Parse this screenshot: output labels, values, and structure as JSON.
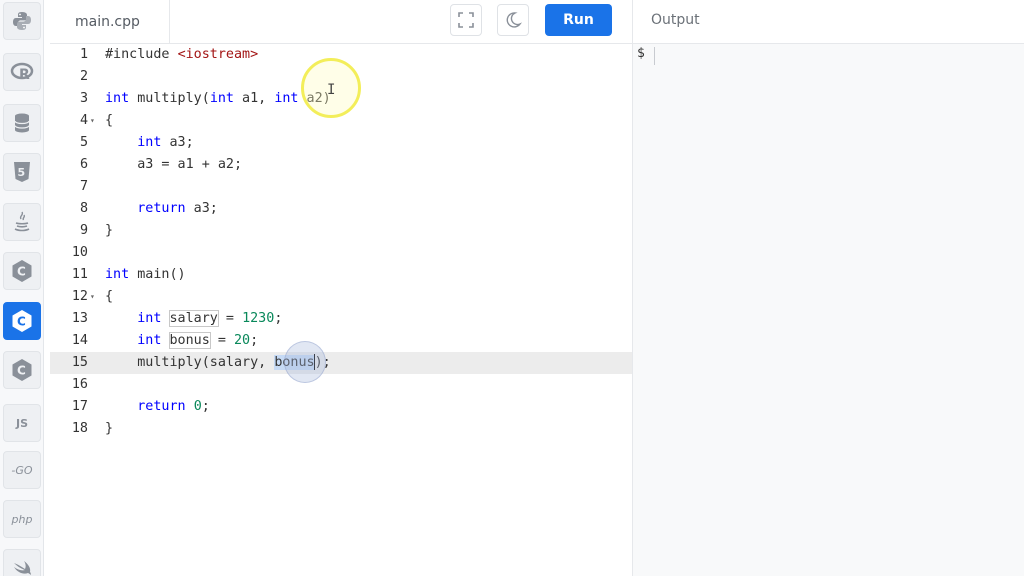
{
  "sidebar": {
    "languages": [
      {
        "name": "python-icon"
      },
      {
        "name": "r-icon"
      },
      {
        "name": "sql-database-icon"
      },
      {
        "name": "html5-icon",
        "label": "5"
      },
      {
        "name": "java-icon"
      },
      {
        "name": "c-icon",
        "label": "C"
      },
      {
        "name": "cpp-icon",
        "label": "C",
        "active": true
      },
      {
        "name": "csharp-icon",
        "label": "C"
      },
      {
        "name": "javascript-icon",
        "label": "JS"
      },
      {
        "name": "go-icon",
        "label": "-GO"
      },
      {
        "name": "php-icon",
        "label": "php"
      },
      {
        "name": "swift-icon"
      }
    ],
    "accent_color": "#1a73e8"
  },
  "toolbar": {
    "file_tab": "main.cpp",
    "fullscreen_icon": "fullscreen-icon",
    "theme_icon": "moon-icon",
    "run_label": "Run",
    "output_label": "Output"
  },
  "editor": {
    "current_line": 15,
    "lines": [
      {
        "n": "1",
        "text": "#include <iostream>"
      },
      {
        "n": "2",
        "text": ""
      },
      {
        "n": "3",
        "text": "int multiply(int a1, int a2)"
      },
      {
        "n": "4",
        "text": "{",
        "fold": true
      },
      {
        "n": "5",
        "text": "    int a3;"
      },
      {
        "n": "6",
        "text": "    a3 = a1 + a2;"
      },
      {
        "n": "7",
        "text": ""
      },
      {
        "n": "8",
        "text": "    return a3;"
      },
      {
        "n": "9",
        "text": "}"
      },
      {
        "n": "10",
        "text": ""
      },
      {
        "n": "11",
        "text": "int main()"
      },
      {
        "n": "12",
        "text": "{",
        "fold": true
      },
      {
        "n": "13",
        "text": "    int salary = 1230;"
      },
      {
        "n": "14",
        "text": "    int bonus = 20;"
      },
      {
        "n": "15",
        "text": "    multiply(salary, bonus);"
      },
      {
        "n": "16",
        "text": ""
      },
      {
        "n": "17",
        "text": "    return 0;"
      },
      {
        "n": "18",
        "text": "}"
      }
    ]
  },
  "output": {
    "prompt": "$"
  }
}
